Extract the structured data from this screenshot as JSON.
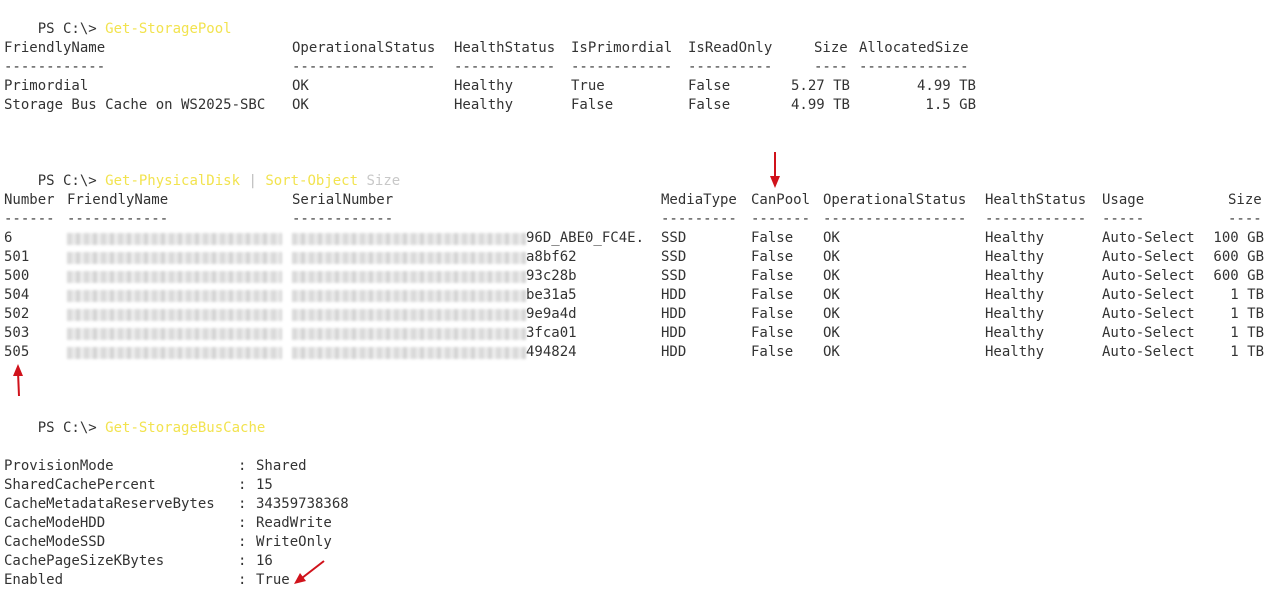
{
  "prompt": "PS C:\\> ",
  "section1": {
    "command": "Get-StoragePool",
    "headers": [
      "FriendlyName",
      "OperationalStatus",
      "HealthStatus",
      "IsPrimordial",
      "IsReadOnly",
      "Size",
      "AllocatedSize"
    ],
    "dashes": [
      "------------",
      "-----------------",
      "------------",
      "------------",
      "----------",
      "----",
      "-------------"
    ],
    "rows": [
      [
        "Primordial",
        "OK",
        "Healthy",
        "True",
        "False",
        "5.27 TB",
        "4.99 TB"
      ],
      [
        "Storage Bus Cache on WS2025-SBC",
        "OK",
        "Healthy",
        "False",
        "False",
        "4.99 TB",
        "1.5 GB"
      ]
    ]
  },
  "section2": {
    "command": "Get-PhysicalDisk",
    "pipe": "|",
    "command2": "Sort-Object",
    "argument": "Size",
    "headers": [
      "Number",
      "FriendlyName",
      "SerialNumber",
      "MediaType",
      "CanPool",
      "OperationalStatus",
      "HealthStatus",
      "Usage",
      "Size"
    ],
    "dashes": [
      "------",
      "------------",
      "------------",
      "---------",
      "-------",
      "-----------------",
      "------------",
      "-----",
      "----"
    ],
    "rows": [
      {
        "number": "6",
        "serial_tail": "96D_ABE0_FC4E.",
        "media": "SSD",
        "canpool": "False",
        "op": "OK",
        "health": "Healthy",
        "usage": "Auto-Select",
        "size": "100 GB"
      },
      {
        "number": "501",
        "serial_tail": "a8bf62",
        "media": "SSD",
        "canpool": "False",
        "op": "OK",
        "health": "Healthy",
        "usage": "Auto-Select",
        "size": "600 GB"
      },
      {
        "number": "500",
        "serial_tail": "93c28b",
        "media": "SSD",
        "canpool": "False",
        "op": "OK",
        "health": "Healthy",
        "usage": "Auto-Select",
        "size": "600 GB"
      },
      {
        "number": "504",
        "serial_tail": "be31a5",
        "media": "HDD",
        "canpool": "False",
        "op": "OK",
        "health": "Healthy",
        "usage": "Auto-Select",
        "size": "1 TB"
      },
      {
        "number": "502",
        "serial_tail": "9e9a4d",
        "media": "HDD",
        "canpool": "False",
        "op": "OK",
        "health": "Healthy",
        "usage": "Auto-Select",
        "size": "1 TB"
      },
      {
        "number": "503",
        "serial_tail": "3fca01",
        "media": "HDD",
        "canpool": "False",
        "op": "OK",
        "health": "Healthy",
        "usage": "Auto-Select",
        "size": "1 TB"
      },
      {
        "number": "505",
        "serial_tail": "494824",
        "media": "HDD",
        "canpool": "False",
        "op": "OK",
        "health": "Healthy",
        "usage": "Auto-Select",
        "size": "1 TB"
      }
    ]
  },
  "section3": {
    "command": "Get-StorageBusCache",
    "separator": ": ",
    "properties": [
      {
        "key": "ProvisionMode",
        "value": "Shared"
      },
      {
        "key": "SharedCachePercent",
        "value": "15"
      },
      {
        "key": "CacheMetadataReserveBytes",
        "value": "34359738368"
      },
      {
        "key": "CacheModeHDD",
        "value": "ReadWrite"
      },
      {
        "key": "CacheModeSSD",
        "value": "WriteOnly"
      },
      {
        "key": "CachePageSizeKBytes",
        "value": "16"
      },
      {
        "key": "Enabled",
        "value": "True"
      }
    ]
  },
  "colors": {
    "background": "#ffffff",
    "text": "#333333",
    "command": "#f2e34f",
    "argument": "#c8c8c8",
    "annotation_arrow": "#d0121b"
  },
  "annotations": [
    "arrow-canpool",
    "arrow-number-505",
    "arrow-enabled-true"
  ]
}
